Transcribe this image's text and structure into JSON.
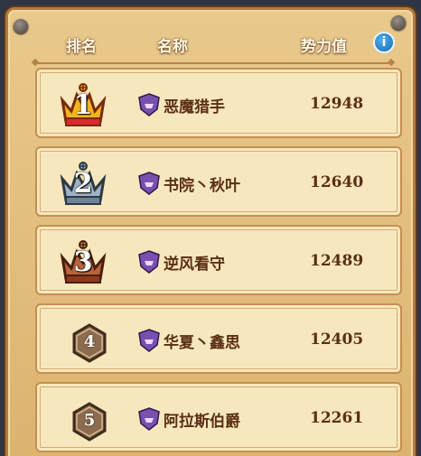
{
  "header": {
    "rank_label": "排名",
    "name_label": "名称",
    "power_label": "势力值",
    "info_icon": "i"
  },
  "rows": [
    {
      "rank": "1",
      "rank_style": "gold-crown",
      "name": "恶魔猎手",
      "power": "12948"
    },
    {
      "rank": "2",
      "rank_style": "silver-crown",
      "name": "书院丶秋叶",
      "power": "12640"
    },
    {
      "rank": "3",
      "rank_style": "bronze-crown",
      "name": "逆风看守",
      "power": "12489"
    },
    {
      "rank": "4",
      "rank_style": "hexagon",
      "name": "华夏丶鑫思",
      "power": "12405"
    },
    {
      "rank": "5",
      "rank_style": "hexagon",
      "name": "阿拉斯伯爵",
      "power": "12261"
    }
  ],
  "colors": {
    "gold": "#f2b51e",
    "silver": "#9fb3c4",
    "bronze": "#b8643d",
    "hexagon": "#8b6c4f",
    "badge": "#7a4fb0"
  }
}
